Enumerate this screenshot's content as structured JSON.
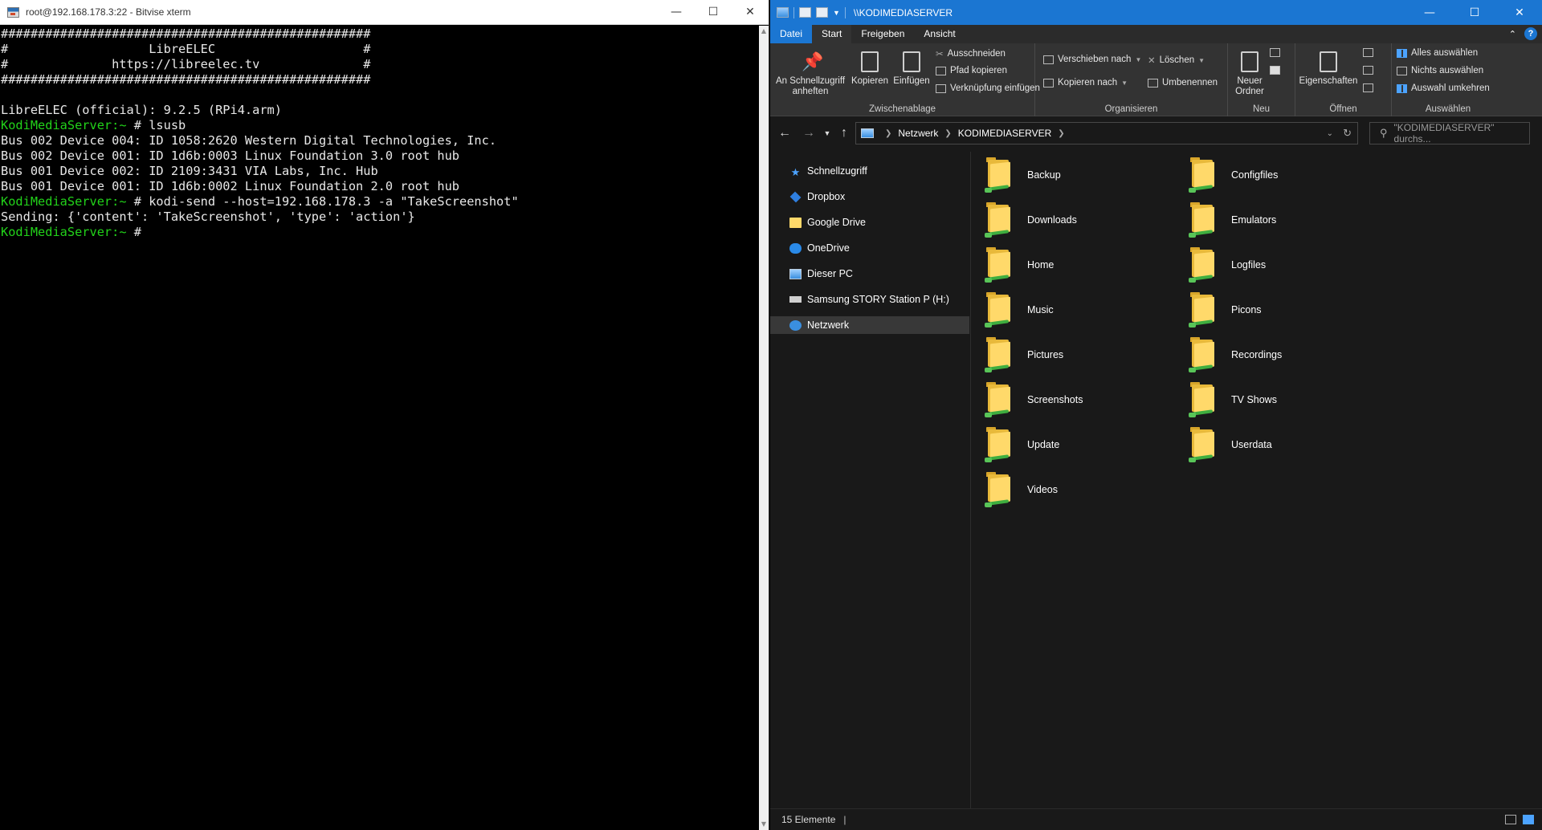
{
  "terminal": {
    "title": "root@192.168.178.3:22 - Bitvise xterm",
    "lines": [
      {
        "text": "##################################################"
      },
      {
        "text": "#                   LibreELEC                    #"
      },
      {
        "text": "#              https://libreelec.tv              #"
      },
      {
        "text": "##################################################"
      },
      {
        "text": ""
      },
      {
        "text": "LibreELEC (official): 9.2.5 (RPi4.arm)"
      },
      {
        "prompt": "KodiMediaServer:~ ",
        "text": "# lsusb"
      },
      {
        "text": "Bus 002 Device 004: ID 1058:2620 Western Digital Technologies, Inc."
      },
      {
        "text": "Bus 002 Device 001: ID 1d6b:0003 Linux Foundation 3.0 root hub"
      },
      {
        "text": "Bus 001 Device 002: ID 2109:3431 VIA Labs, Inc. Hub"
      },
      {
        "text": "Bus 001 Device 001: ID 1d6b:0002 Linux Foundation 2.0 root hub"
      },
      {
        "prompt": "KodiMediaServer:~ ",
        "text": "# kodi-send --host=192.168.178.3 -a \"TakeScreenshot\""
      },
      {
        "text": "Sending: {'content': 'TakeScreenshot', 'type': 'action'}"
      },
      {
        "prompt": "KodiMediaServer:~ ",
        "text": "# "
      }
    ],
    "colors": {
      "prompt": "#22d31a",
      "text": "#e8e8e8",
      "background": "#000000"
    }
  },
  "explorer": {
    "title": "\\\\KODIMEDIASERVER",
    "accent": "#1b76d2",
    "tabs": [
      {
        "label": "Datei"
      },
      {
        "label": "Start"
      },
      {
        "label": "Freigeben"
      },
      {
        "label": "Ansicht"
      }
    ],
    "ribbon": {
      "clipboard": {
        "group_label": "Zwischenablage",
        "pin_line1": "An Schnellzugriff",
        "pin_line2": "anheften",
        "copy": "Kopieren",
        "paste": "Einfügen",
        "cut": "Ausschneiden",
        "copy_path": "Pfad kopieren",
        "paste_shortcut": "Verknüpfung einfügen"
      },
      "organize": {
        "group_label": "Organisieren",
        "move_to": "Verschieben nach",
        "copy_to": "Kopieren nach",
        "delete": "Löschen",
        "rename": "Umbenennen"
      },
      "new": {
        "group_label": "Neu",
        "new_folder_line1": "Neuer",
        "new_folder_line2": "Ordner"
      },
      "open": {
        "group_label": "Öffnen",
        "properties": "Eigenschaften"
      },
      "select": {
        "group_label": "Auswählen",
        "select_all": "Alles auswählen",
        "select_none": "Nichts auswählen",
        "invert": "Auswahl umkehren"
      }
    },
    "address": {
      "crumbs": [
        "Netzwerk",
        "KODIMEDIASERVER"
      ]
    },
    "search": {
      "placeholder": "\"KODIMEDIASERVER\" durchs..."
    },
    "nav": [
      {
        "label": "Schnellzugriff",
        "icon": "star-icon"
      },
      {
        "label": "Dropbox",
        "icon": "dropbox-icon"
      },
      {
        "label": "Google Drive",
        "icon": "folder-icon"
      },
      {
        "label": "OneDrive",
        "icon": "cloud-icon"
      },
      {
        "label": "Dieser PC",
        "icon": "computer-icon"
      },
      {
        "label": "Samsung STORY Station P (H:)",
        "icon": "drive-icon"
      },
      {
        "label": "Netzwerk",
        "icon": "network-icon",
        "selected": true
      }
    ],
    "folders": [
      {
        "name": "Backup"
      },
      {
        "name": "Configfiles"
      },
      {
        "name": "Downloads"
      },
      {
        "name": "Emulators"
      },
      {
        "name": "Home"
      },
      {
        "name": "Logfiles"
      },
      {
        "name": "Music"
      },
      {
        "name": "Picons"
      },
      {
        "name": "Pictures"
      },
      {
        "name": "Recordings"
      },
      {
        "name": "Screenshots"
      },
      {
        "name": "TV Shows"
      },
      {
        "name": "Update"
      },
      {
        "name": "Userdata"
      },
      {
        "name": "Videos"
      }
    ],
    "status": {
      "count": "15 Elemente"
    }
  }
}
